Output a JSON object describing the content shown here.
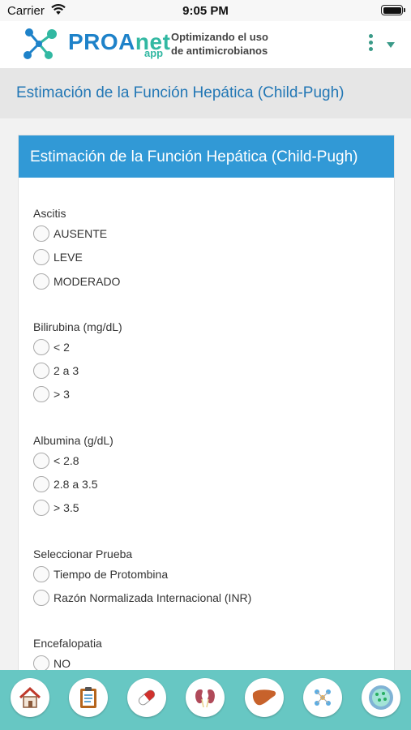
{
  "status_bar": {
    "carrier": "Carrier",
    "time": "9:05 PM"
  },
  "header": {
    "logo_main": "PROA",
    "logo_accent": "net",
    "logo_sub": "app",
    "tagline_line1": "Optimizando el uso",
    "tagline_line2": "de antimicrobianos",
    "menu_icon": "more-vertical-icon"
  },
  "page": {
    "title": "Estimación de la Función Hepática (Child-Pugh)"
  },
  "card": {
    "title": "Estimación de la Función Hepática (Child-Pugh)",
    "sections": [
      {
        "label": "Ascitis",
        "options": [
          "AUSENTE",
          "LEVE",
          "MODERADO"
        ]
      },
      {
        "label": "Bilirubina (mg/dL)",
        "options": [
          "< 2",
          "2 a 3",
          "> 3"
        ]
      },
      {
        "label": "Albumina (g/dL)",
        "options": [
          "< 2.8",
          "2.8 a 3.5",
          "> 3.5"
        ]
      },
      {
        "label": "Seleccionar Prueba",
        "options": [
          "Tiempo de Protombina",
          "Razón Normalizada Internacional (INR)"
        ]
      },
      {
        "label": "Encefalopatia",
        "options": [
          "NO"
        ]
      }
    ]
  },
  "bottom_nav": [
    {
      "name": "home-icon"
    },
    {
      "name": "clipboard-icon"
    },
    {
      "name": "pill-icon"
    },
    {
      "name": "kidney-icon"
    },
    {
      "name": "liver-icon"
    },
    {
      "name": "molecule-icon"
    },
    {
      "name": "bacteria-icon"
    }
  ],
  "colors": {
    "primary": "#3199d6",
    "title_text": "#2277b5",
    "nav_bg": "#67c7c3",
    "logo_blue": "#1e82c9",
    "logo_green": "#32b8a2"
  }
}
